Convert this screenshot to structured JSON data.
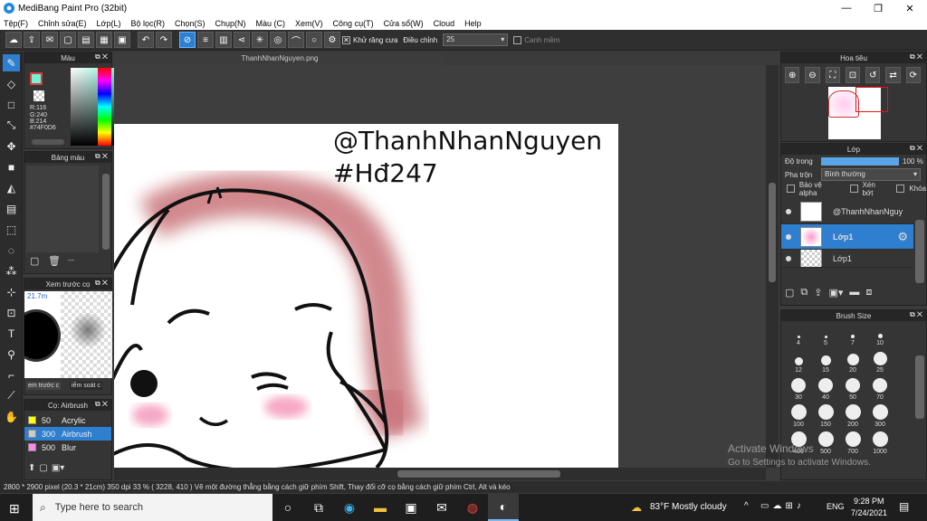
{
  "window": {
    "title": "MediBang Paint Pro (32bit)",
    "min": "—",
    "max": "❐",
    "close": "✕"
  },
  "menu": [
    "Tệp(F)",
    "Chỉnh sửa(E)",
    "Lớp(L)",
    "Bộ lọc(R)",
    "Chọn(S)",
    "Chụp(N)",
    "Màu (C)",
    "Xem(V)",
    "Công cụ(T)",
    "Cửa sổ(W)",
    "Cloud",
    "Help"
  ],
  "toolbar": {
    "antialias_label": "Khử răng cưa",
    "adjust_label": "Điều chỉnh",
    "adjust_value": "25",
    "snap_label": "Canh mềm",
    "antialias_check": "✕"
  },
  "document": {
    "tab": "ThanhNhanNguyen.png",
    "text_line1": "@ThanhNhanNguyen",
    "text_line2": "#Hđ247"
  },
  "color_panel": {
    "title": "Màu",
    "r": "R:116",
    "g": "G:240",
    "b": "B:214",
    "hex": "#74F0D6",
    "current": "#74f0d6"
  },
  "palette_panel": {
    "title": "Bảng màu",
    "tail": "---"
  },
  "brush_preview": {
    "title": "Xem trước cọ",
    "size": "21.7m",
    "tab1": "em trước c",
    "tab2": "iểm soát c"
  },
  "brush_panel": {
    "title": "Cọ: Airbrush",
    "items": [
      {
        "size": "50",
        "name": "Acrylic",
        "color": "#ffff00"
      },
      {
        "size": "300",
        "name": "Airbrush",
        "color": "#cccccc"
      },
      {
        "size": "500",
        "name": "Blur",
        "color": "#ff88ee"
      }
    ]
  },
  "navigator": {
    "title": "Hoa tiêu"
  },
  "layer_panel": {
    "title": "Lớp",
    "opacity_label": "Độ trong",
    "opacity_value": "100 %",
    "opacity": 1.0,
    "blend_label": "Pha trộn",
    "blend_value": "Bình thường",
    "protect_alpha": "Bảo vệ alpha",
    "clipping": "Xén bớt",
    "lock": "Khóa",
    "layers": [
      {
        "name": "@ThanhNhanNguy"
      },
      {
        "name": "Lớp1"
      },
      {
        "name": "Lớp1"
      }
    ]
  },
  "brush_size": {
    "title": "Brush Size",
    "sizes": [
      "4",
      "5",
      "7",
      "10",
      "12",
      "15",
      "20",
      "25",
      "30",
      "40",
      "50",
      "70",
      "100",
      "150",
      "200",
      "300",
      "400",
      "500",
      "700",
      "1000"
    ]
  },
  "status": "2800 * 2900 pixel   (20.3 * 21cm)   350 dpi   33 %   ( 3228, 410 )   Vẽ một đường thẳng bằng cách giữ phím Shift, Thay đổi cỡ cọ bằng cách giữ phím Ctrl, Alt và kéo",
  "watermark": {
    "line1": "Activate Windows",
    "line2": "Go to Settings to activate Windows."
  },
  "taskbar": {
    "search": "Type here to search",
    "weather": "83°F  Mostly cloudy",
    "lang": "ENG",
    "time": "9:28 PM",
    "date": "7/24/2021"
  }
}
